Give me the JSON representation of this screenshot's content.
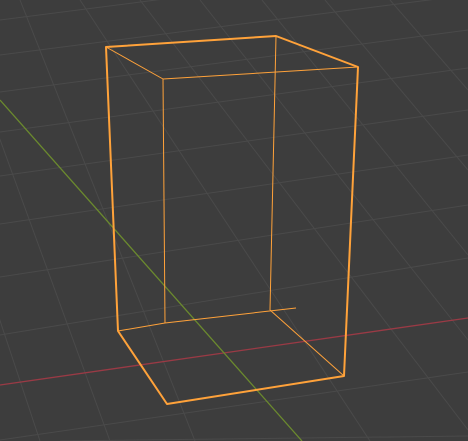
{
  "viewport": {
    "editor": "3D Viewport",
    "shading": "wireframe",
    "view": "perspective",
    "selected_object": "Cube",
    "selection_state": "selected",
    "scale": [
      1,
      1,
      2
    ]
  },
  "colors": {
    "background": "#3d3d3d",
    "grid_line": "#4a4a4a",
    "x_axis": "#9a3a45",
    "y_axis": "#6b8a2e",
    "selection_outline": "#ffa23a"
  }
}
